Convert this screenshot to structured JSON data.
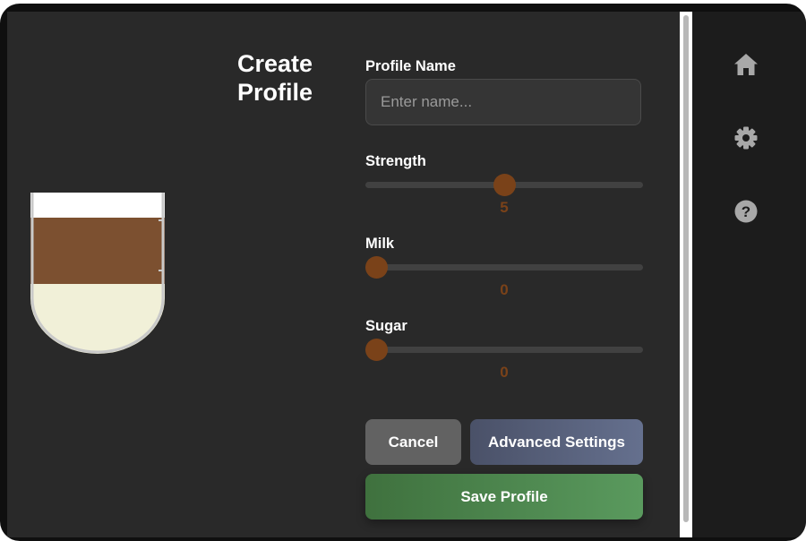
{
  "title": {
    "line1": "Create",
    "line2": "Profile"
  },
  "profile_name": {
    "label": "Profile Name",
    "placeholder": "Enter name...",
    "value": ""
  },
  "sliders": {
    "strength": {
      "label": "Strength",
      "value": "5",
      "min": 0,
      "max": 10
    },
    "milk": {
      "label": "Milk",
      "value": "0",
      "min": 0,
      "max": 10
    },
    "sugar": {
      "label": "Sugar",
      "value": "0",
      "min": 0,
      "max": 10
    }
  },
  "buttons": {
    "cancel": "Cancel",
    "advanced": "Advanced Settings",
    "save": "Save Profile"
  },
  "nav": {
    "icons": [
      "home-icon",
      "gear-icon",
      "help-icon"
    ]
  },
  "colors": {
    "accent": "#7a4219",
    "coffee": "#7c5030",
    "milk_foam": "#f1f0d8",
    "save": "#4a8a4f",
    "advanced": "#5a637e"
  }
}
